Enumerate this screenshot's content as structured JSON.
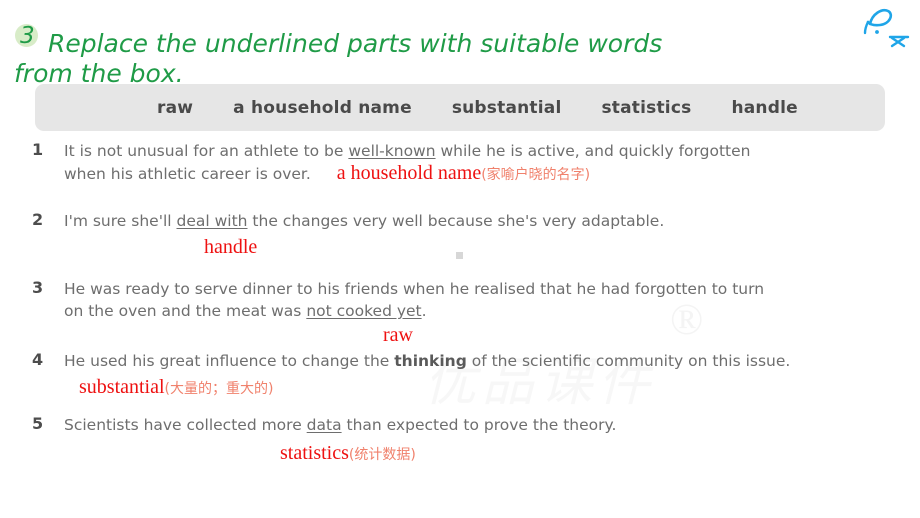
{
  "heading": {
    "number": "3",
    "line1": "Replace the underlined parts with suitable words",
    "line2": "from the box."
  },
  "wordbank": {
    "words": [
      "raw",
      "a household name",
      "substantial",
      "statistics",
      "handle"
    ]
  },
  "exercises": [
    {
      "number": "1",
      "line1_pre": "It is not unusual for an athlete to be ",
      "line1_underlined": "well-known",
      "line1_post": " while he is active, and quickly forgotten",
      "line2": "when his athletic career is over.",
      "answer": "a household name",
      "gloss": "(家喻户晓的名字)"
    },
    {
      "number": "2",
      "line1_pre": "I'm sure she'll ",
      "line1_underlined": "deal with",
      "line1_post": " the changes very well because she's very adaptable.",
      "line2": "",
      "answer": "handle",
      "gloss": ""
    },
    {
      "number": "3",
      "line1_pre": "He was ready to serve dinner to his friends when he realised that he had forgotten to turn",
      "line1_underlined": "",
      "line1_post": "",
      "line2_pre": "on the oven and the meat was ",
      "line2_underlined": "not cooked yet",
      "line2_post": ".",
      "answer": "raw",
      "gloss": ""
    },
    {
      "number": "4",
      "line1_pre": "He used his great influence to change the ",
      "line1_bold": "thinking",
      "line1_post": " of the scientific community on this issue.",
      "line2": "",
      "answer": "substantial",
      "gloss": "(大量的；重大的)"
    },
    {
      "number": "5",
      "line1_pre": "Scientists have collected more ",
      "line1_underlined": "data",
      "line1_post": " than expected to prove the theory.",
      "line2": "",
      "answer": "statistics",
      "gloss": "(统计数据)"
    }
  ],
  "watermark": {
    "script_text": "优品课件",
    "registered_mark": "®"
  },
  "colors": {
    "heading_green": "#1f9b47",
    "badge_green": "#d8ecc8",
    "answer_red": "#ee1111",
    "gloss_red": "#f0816c",
    "body_gray": "#6e6e6e",
    "wordbank_bg": "#e6e6e6",
    "logo_blue": "#1fa5e8"
  }
}
